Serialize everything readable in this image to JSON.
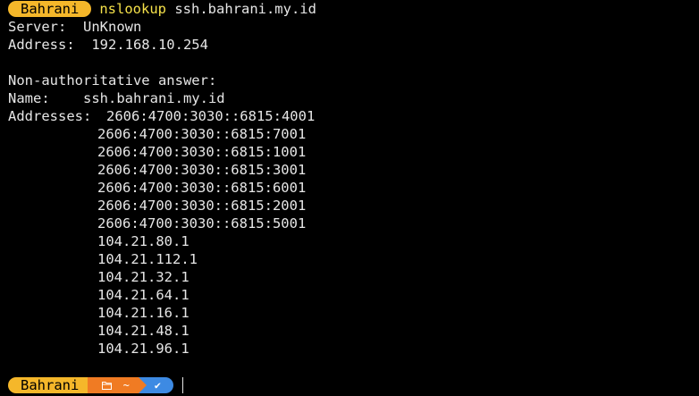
{
  "terminal": {
    "prompt1": {
      "user": "Bahrani",
      "command": "nslookup",
      "argument": "ssh.bahrani.my.id"
    },
    "output": {
      "server_line": "Server:  UnKnown",
      "address_line": "Address:  192.168.10.254",
      "non_auth": "Non-authoritative answer:",
      "name_line": "Name:    ssh.bahrani.my.id",
      "addresses_label": "Addresses:  ",
      "addresses": [
        "2606:4700:3030::6815:4001",
        "2606:4700:3030::6815:7001",
        "2606:4700:3030::6815:1001",
        "2606:4700:3030::6815:3001",
        "2606:4700:3030::6815:6001",
        "2606:4700:3030::6815:2001",
        "2606:4700:3030::6815:5001",
        "104.21.80.1",
        "104.21.112.1",
        "104.21.32.1",
        "104.21.64.1",
        "104.21.16.1",
        "104.21.48.1",
        "104.21.96.1"
      ]
    },
    "prompt2": {
      "user": "Bahrani",
      "folder_icon": "folder-icon",
      "path": "~",
      "status_icon": "check-icon",
      "status_glyph": "✔"
    }
  },
  "colors": {
    "background": "#000000",
    "text": "#e6e6e6",
    "command": "#f5e14a",
    "user_segment": "#f5b72a",
    "path_segment": "#f07b23",
    "status_segment": "#3d8ae3"
  }
}
